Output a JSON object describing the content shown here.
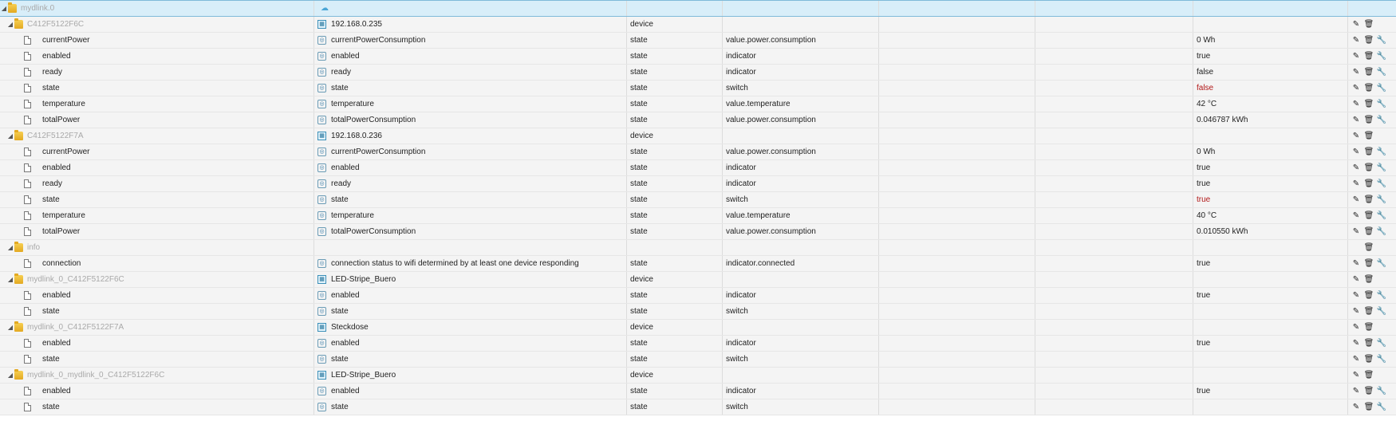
{
  "root": {
    "name": "mydlink.0"
  },
  "rows": [
    {
      "kind": "device",
      "name": "C412F5122F6C",
      "desc": "192.168.0.235",
      "type": "device",
      "role": "",
      "value": ""
    },
    {
      "kind": "state",
      "name": "currentPower",
      "desc": "currentPowerConsumption",
      "type": "state",
      "role": "value.power.consumption",
      "value": "0 Wh"
    },
    {
      "kind": "state",
      "name": "enabled",
      "desc": "enabled",
      "type": "state",
      "role": "indicator",
      "value": "true"
    },
    {
      "kind": "state",
      "name": "ready",
      "desc": "ready",
      "type": "state",
      "role": "indicator",
      "value": "false"
    },
    {
      "kind": "state",
      "name": "state",
      "desc": "state",
      "type": "state",
      "role": "switch",
      "value": "false",
      "value_color": "#b21818"
    },
    {
      "kind": "state",
      "name": "temperature",
      "desc": "temperature",
      "type": "state",
      "role": "value.temperature",
      "value": "42 °C"
    },
    {
      "kind": "state",
      "name": "totalPower",
      "desc": "totalPowerConsumption",
      "type": "state",
      "role": "value.power.consumption",
      "value": "0.046787 kWh"
    },
    {
      "kind": "device",
      "name": "C412F5122F7A",
      "desc": "192.168.0.236",
      "type": "device",
      "role": "",
      "value": ""
    },
    {
      "kind": "state",
      "name": "currentPower",
      "desc": "currentPowerConsumption",
      "type": "state",
      "role": "value.power.consumption",
      "value": "0 Wh"
    },
    {
      "kind": "state",
      "name": "enabled",
      "desc": "enabled",
      "type": "state",
      "role": "indicator",
      "value": "true"
    },
    {
      "kind": "state",
      "name": "ready",
      "desc": "ready",
      "type": "state",
      "role": "indicator",
      "value": "true"
    },
    {
      "kind": "state",
      "name": "state",
      "desc": "state",
      "type": "state",
      "role": "switch",
      "value": "true",
      "value_color": "#b21818"
    },
    {
      "kind": "state",
      "name": "temperature",
      "desc": "temperature",
      "type": "state",
      "role": "value.temperature",
      "value": "40 °C"
    },
    {
      "kind": "state",
      "name": "totalPower",
      "desc": "totalPowerConsumption",
      "type": "state",
      "role": "value.power.consumption",
      "value": "0.010550 kWh"
    },
    {
      "kind": "channel",
      "name": "info",
      "desc": "",
      "type": "",
      "role": "",
      "value": ""
    },
    {
      "kind": "state",
      "name": "connection",
      "desc": "connection status to wifi determined by at least one device responding",
      "type": "state",
      "role": "indicator.connected",
      "value": "true"
    },
    {
      "kind": "device",
      "name": "mydlink_0_C412F5122F6C",
      "desc": "LED-Stripe_Buero",
      "type": "device",
      "role": "",
      "value": ""
    },
    {
      "kind": "state",
      "name": "enabled",
      "desc": "enabled",
      "type": "state",
      "role": "indicator",
      "value": "true"
    },
    {
      "kind": "state",
      "name": "state",
      "desc": "state",
      "type": "state",
      "role": "switch",
      "value": ""
    },
    {
      "kind": "device",
      "name": "mydlink_0_C412F5122F7A",
      "desc": "Steckdose",
      "type": "device",
      "role": "",
      "value": ""
    },
    {
      "kind": "state",
      "name": "enabled",
      "desc": "enabled",
      "type": "state",
      "role": "indicator",
      "value": "true"
    },
    {
      "kind": "state",
      "name": "state",
      "desc": "state",
      "type": "state",
      "role": "switch",
      "value": ""
    },
    {
      "kind": "device",
      "name": "mydlink_0_mydlink_0_C412F5122F6C",
      "desc": "LED-Stripe_Buero",
      "type": "device",
      "role": "",
      "value": ""
    },
    {
      "kind": "state",
      "name": "enabled",
      "desc": "enabled",
      "type": "state",
      "role": "indicator",
      "value": "true"
    },
    {
      "kind": "state",
      "name": "state",
      "desc": "state",
      "type": "state",
      "role": "switch",
      "value": ""
    }
  ],
  "icons": {
    "edit": "pencil-icon",
    "delete": "trash-icon",
    "settings": "wrench-icon",
    "expand": "triangle-down-icon",
    "folder": "folder-icon",
    "file": "file-icon"
  }
}
